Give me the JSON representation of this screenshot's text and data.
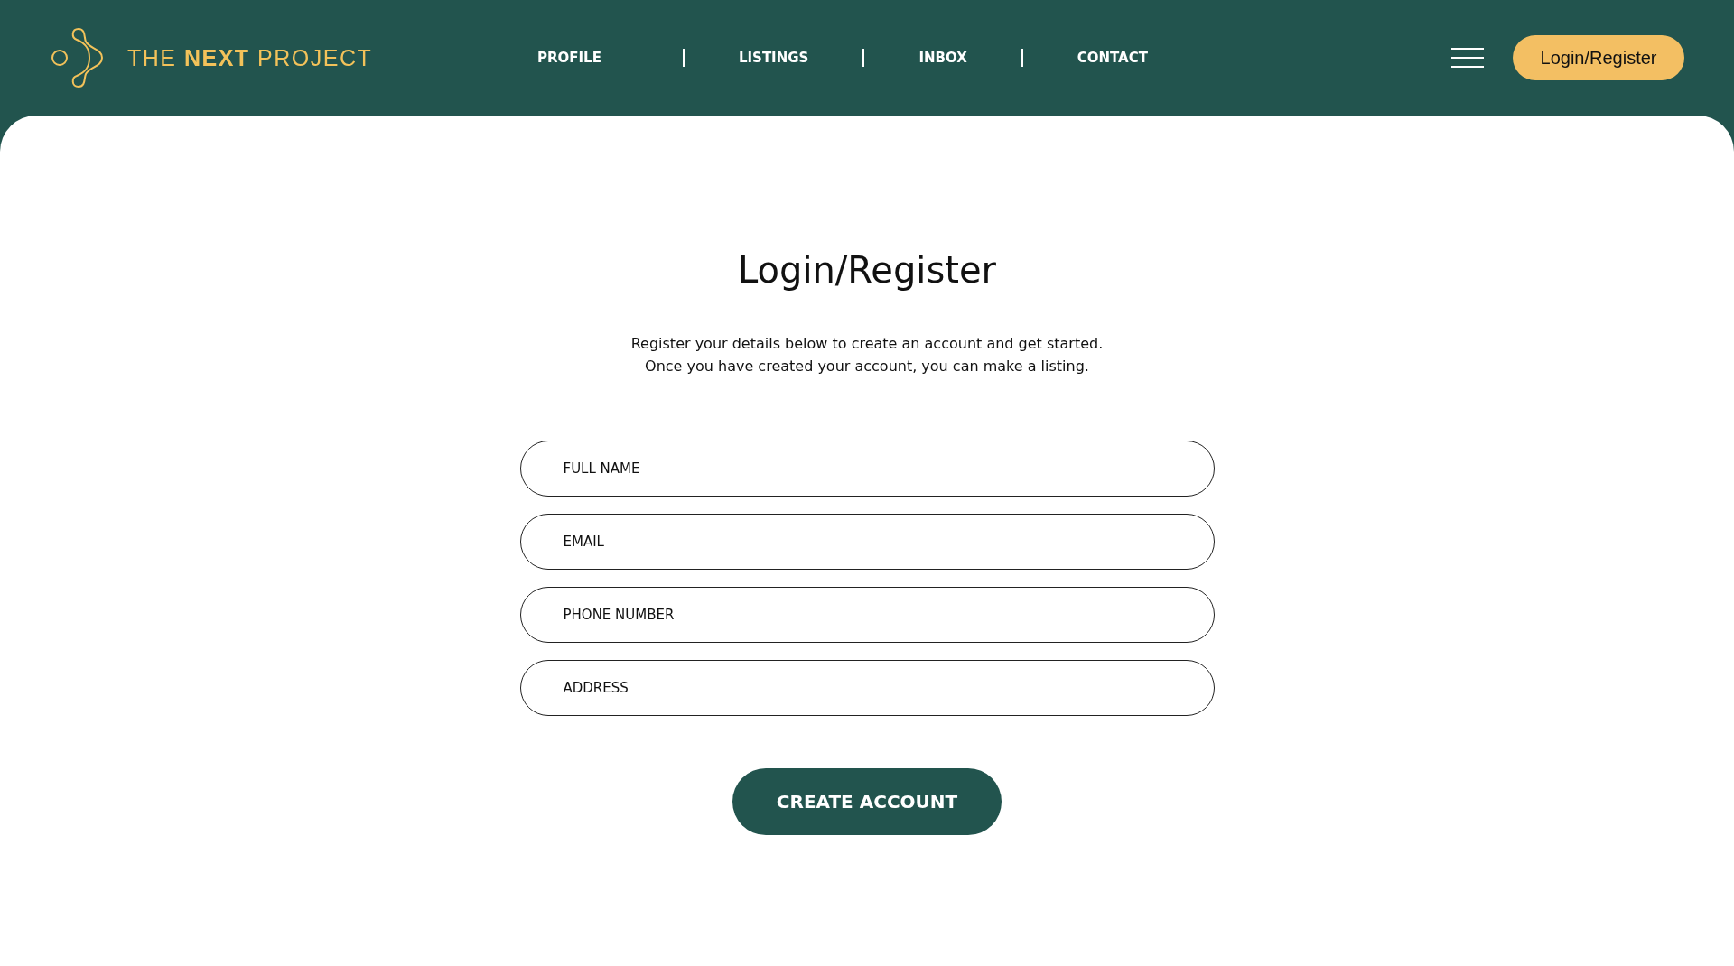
{
  "header": {
    "logo": "THE **NEXT** PROJECT",
    "nav": [
      {
        "label": "PROFILE"
      },
      {
        "label": "LISTINGS"
      },
      {
        "label": "INBOX"
      },
      {
        "label": "CONTACT"
      }
    ],
    "login_button": "Login/Register"
  },
  "title": "Login/Register",
  "intro": [
    "Register your details below to create an account and get started.",
    "Once you have created your account, you can make a listing."
  ],
  "fields": [
    {
      "placeholder": "FULL NAME"
    },
    {
      "placeholder": "EMAIL"
    },
    {
      "placeholder": "PHONE NUMBER"
    },
    {
      "placeholder": "ADDRESS"
    }
  ],
  "submit": "CREATE ACCOUNT"
}
